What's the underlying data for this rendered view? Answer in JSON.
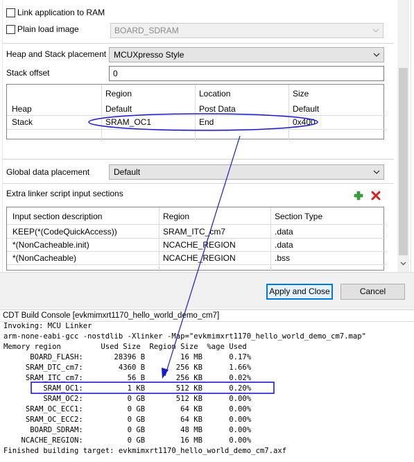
{
  "options": {
    "link_to_ram": "Link application to RAM",
    "plain_load_image": "Plain load image",
    "plain_load_image_target": "BOARD_SDRAM",
    "heap_stack_placement_label": "Heap and Stack placement",
    "heap_stack_placement_value": "MCUXpresso Style",
    "stack_offset_label": "Stack offset",
    "stack_offset_value": "0"
  },
  "heap_stack_table": {
    "columns": [
      "Region",
      "Location",
      "Size"
    ],
    "rows": [
      {
        "name": "Heap",
        "region": "Default",
        "location": "Post Data",
        "size": "Default"
      },
      {
        "name": "Stack",
        "region": "SRAM_OC1",
        "location": "End",
        "size": "0x400"
      }
    ]
  },
  "global_data": {
    "label": "Global data placement",
    "value": "Default"
  },
  "extra_sections": {
    "label": "Extra linker script input sections",
    "columns": [
      "Input section description",
      "Region",
      "Section Type"
    ],
    "rows": [
      {
        "desc": "KEEP(*(CodeQuickAccess))",
        "region": "SRAM_ITC_cm7",
        "type": ".data"
      },
      {
        "desc": "*(NonCacheable.init)",
        "region": "NCACHE_REGION",
        "type": ".data"
      },
      {
        "desc": "*(NonCacheable)",
        "region": "NCACHE_REGION",
        "type": ".bss"
      }
    ]
  },
  "buttons": {
    "apply_close": "Apply and Close",
    "cancel": "Cancel"
  },
  "console": {
    "title": "CDT Build Console [evkmimxrt1170_hello_world_demo_cm7]",
    "lines": [
      "Invoking: MCU Linker",
      "arm-none-eabi-gcc -nostdlib -Xlinker -Map=\"evkmimxrt1170_hello_world_demo_cm7.map\"",
      "Memory region         Used Size  Region Size  %age Used",
      "      BOARD_FLASH:       28396 B        16 MB      0.17%",
      "     SRAM_DTC_cm7:        4360 B       256 KB      1.66%",
      "     SRAM_ITC_cm7:          56 B       256 KB      0.02%",
      "         SRAM_OC1:          1 KB       512 KB      0.20%",
      "         SRAM_OC2:          0 GB       512 KB      0.00%",
      "     SRAM_OC_ECC1:          0 GB        64 KB      0.00%",
      "     SRAM_OC_ECC2:          0 GB        64 KB      0.00%",
      "      BOARD_SDRAM:          0 GB        48 MB      0.00%",
      "    NCACHE_REGION:          0 GB        16 MB      0.00%",
      "Finished building target: evkmimxrt1170_hello_world_demo_cm7.axf"
    ]
  },
  "colors": {
    "annotation": "#1a1acc",
    "console_bg": "#ffffff"
  }
}
